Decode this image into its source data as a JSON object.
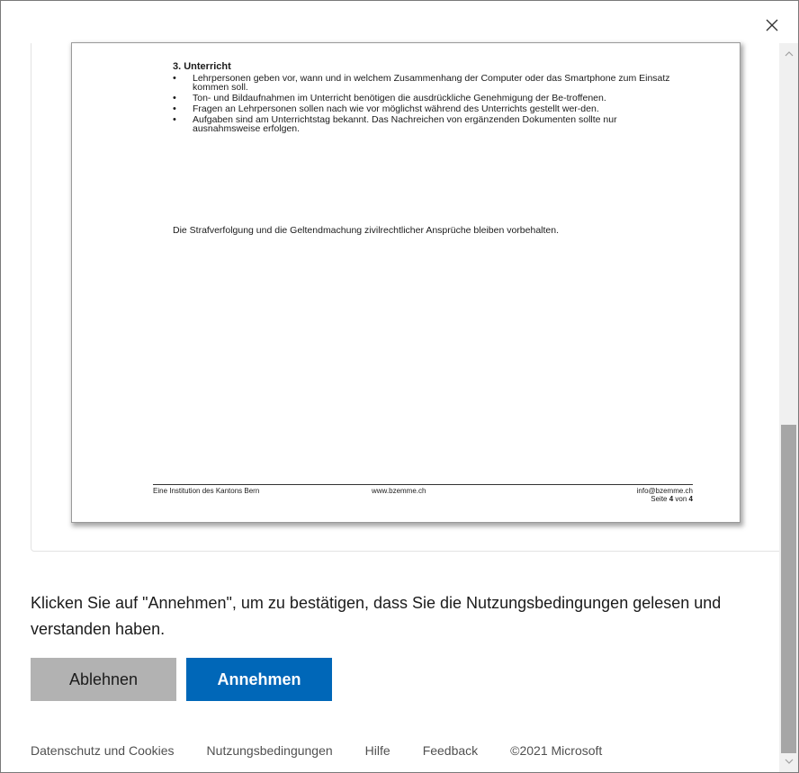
{
  "document": {
    "section_heading": "3. Unterricht",
    "bullets": [
      "Lehrpersonen geben vor, wann und in welchem Zusammenhang der Computer oder das Smartphone zum Einsatz kommen soll.",
      "Ton- und Bildaufnahmen im Unterricht benötigen die ausdrückliche Genehmigung der Be-troffenen.",
      "Fragen an Lehrpersonen sollen nach wie vor möglichst während des Unterrichts gestellt wer-den.",
      "Aufgaben sind am Unterrichtstag bekannt. Das Nachreichen von ergänzenden Dokumenten sollte nur ausnahmsweise erfolgen."
    ],
    "note": "Die Strafverfolgung und die Geltendmachung zivilrechtlicher Ansprüche bleiben vorbehalten.",
    "footer": {
      "left": "Eine Institution des Kantons Bern",
      "middle": "www.bzemme.ch",
      "email": "info@bzemme.ch",
      "page_prefix": "Seite",
      "page_current": "4",
      "page_sep": "von",
      "page_total": "4"
    }
  },
  "prompt": "Klicken Sie auf \"Annehmen\", um zu bestätigen, dass Sie die Nutzungsbedingungen gelesen und verstanden haben.",
  "buttons": {
    "decline": "Ablehnen",
    "accept": "Annehmen"
  },
  "footer_links": {
    "privacy": "Datenschutz und Cookies",
    "terms": "Nutzungsbedingungen",
    "help": "Hilfe",
    "feedback": "Feedback",
    "copyright": "©2021 Microsoft"
  },
  "colors": {
    "accent": "#0067b8",
    "decline_bg": "#b2b2b2"
  },
  "icons": {
    "close": "close-icon",
    "scroll_up": "chevron-up-icon",
    "scroll_down": "chevron-down-icon"
  }
}
